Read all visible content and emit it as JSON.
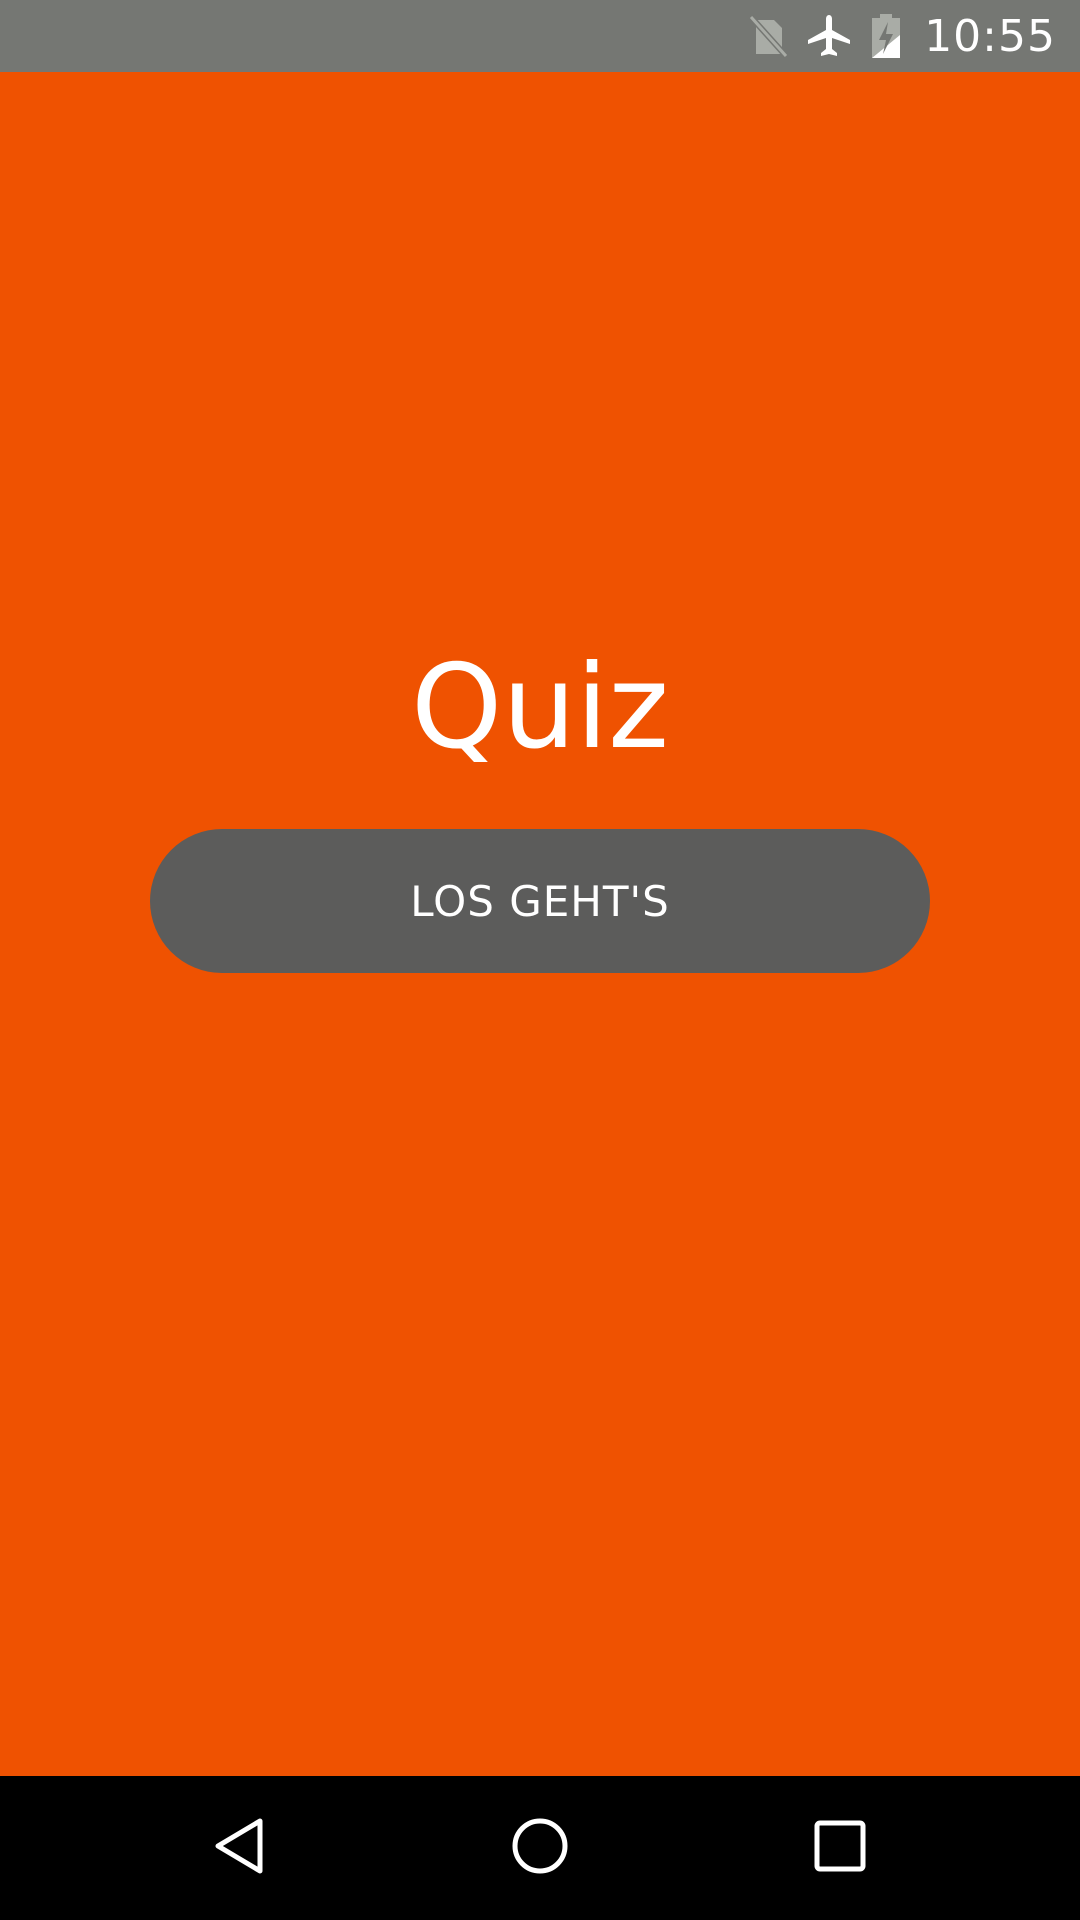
{
  "status_bar": {
    "time": "10:55",
    "icons": [
      "no-sim-icon",
      "airplane-mode-icon",
      "battery-charging-icon"
    ]
  },
  "main": {
    "title": "Quiz",
    "start_button_label": "LOS GEHT'S"
  },
  "nav_bar": {
    "icons": [
      "back-icon",
      "home-icon",
      "recents-icon"
    ]
  },
  "colors": {
    "background": "#ef5201",
    "status_bar": "#757773",
    "button": "#5c5c5b",
    "nav_bar": "#000000",
    "text": "#ffffff"
  }
}
